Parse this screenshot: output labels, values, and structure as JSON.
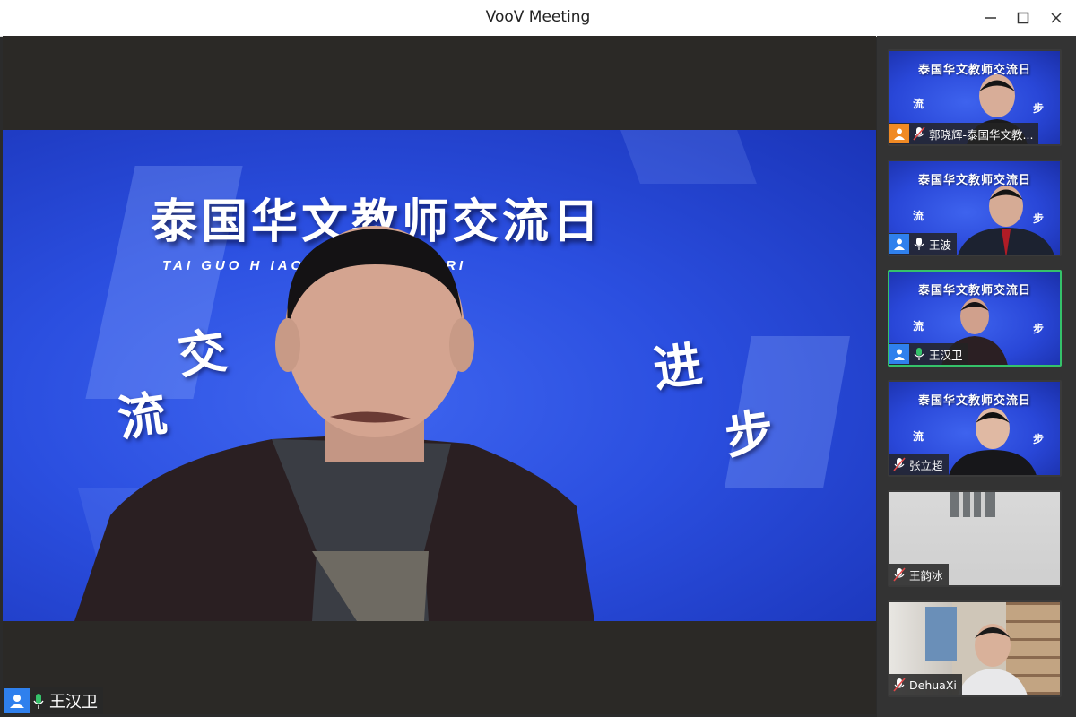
{
  "window": {
    "title": "VooV Meeting"
  },
  "main": {
    "banner_title": "泰国华文教师交流日",
    "banner_pinyin": "TAI GUO H          IAO SHI JIAO LIU RI",
    "calligraphy": [
      "交",
      "流",
      "进",
      "步"
    ],
    "speaker_name": "王汉卫",
    "speaker_mic": "mic-on-green"
  },
  "participants": [
    {
      "name": "郭晓辉-泰国华文教...",
      "avatar": "orange",
      "mic": "muted"
    },
    {
      "name": "王波",
      "avatar": "blue",
      "mic": "on"
    },
    {
      "name": "王汉卫",
      "avatar": "blue",
      "mic": "on-green",
      "active": true
    },
    {
      "name": "张立超",
      "avatar": "",
      "mic": "muted"
    },
    {
      "name": "王韵冰",
      "avatar": "",
      "mic": "muted"
    },
    {
      "name": "DehuaXi",
      "avatar": "",
      "mic": "muted"
    }
  ],
  "tile_banner": "泰国华文教师交流日",
  "colors": {
    "accent_green": "#35c26a",
    "avatar_blue": "#2f80ed",
    "avatar_orange": "#f08a24",
    "muted_red": "#e04848"
  }
}
